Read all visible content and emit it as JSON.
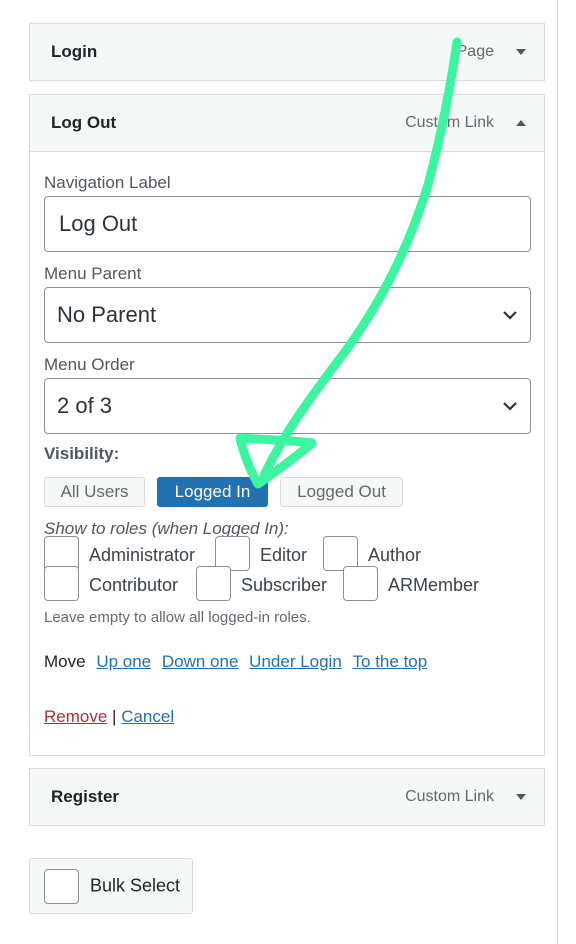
{
  "menu_items": [
    {
      "title": "Login",
      "type": "Page",
      "expanded": false
    },
    {
      "title": "Log Out",
      "type": "Custom Link",
      "expanded": true
    },
    {
      "title": "Register",
      "type": "Custom Link",
      "expanded": false
    }
  ],
  "settings": {
    "nav_label": {
      "label": "Navigation Label",
      "value": "Log Out"
    },
    "menu_parent": {
      "label": "Menu Parent",
      "value": "No Parent"
    },
    "menu_order": {
      "label": "Menu Order",
      "value": "2 of 3"
    },
    "visibility": {
      "title": "Visibility:",
      "options": [
        "All Users",
        "Logged In",
        "Logged Out"
      ],
      "selected": "Logged In"
    },
    "roles": {
      "title": "Show to roles (when Logged In):",
      "items": [
        "Administrator",
        "Editor",
        "Author",
        "Contributor",
        "Subscriber",
        "ARMember"
      ],
      "help": "Leave empty to allow all logged-in roles."
    },
    "move": {
      "label": "Move",
      "links": [
        "Up one",
        "Down one",
        "Under Login",
        "To the top"
      ]
    },
    "actions": {
      "remove": "Remove",
      "separator": "|",
      "cancel": "Cancel"
    }
  },
  "bulk_select": {
    "label": "Bulk Select"
  },
  "annotation": {
    "color": "#3cf5a0"
  },
  "colors": {
    "accent": "#2271b1",
    "danger": "#b32d2e",
    "border": "#dcdcde",
    "bar_bg": "#f6f7f7"
  },
  "icons": {
    "collapsed": "chevron-down-icon",
    "expanded": "chevron-up-icon",
    "select": "chevron-down-icon"
  }
}
